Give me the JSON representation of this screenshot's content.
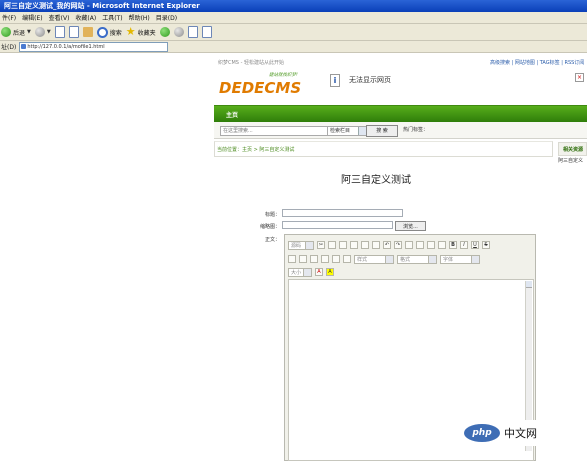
{
  "window": {
    "title": "阿三自定义测试_我的网站 - Microsoft Internet Explorer"
  },
  "menu": [
    "件(F)",
    "编辑(E)",
    "查看(V)",
    "收藏(A)",
    "工具(T)",
    "帮助(H)",
    "目录(D)"
  ],
  "toolbar": {
    "back_label": "后退",
    "search_label": "搜索",
    "favorites_label": "收藏夹"
  },
  "address": {
    "label": "址(D)",
    "url": "http://127.0.0.1/a/mofile1.html"
  },
  "site": {
    "topline": "织梦CMS - 轻松建站从此开始",
    "toplinks": "高级搜索 | 网站地图 | TAG标签 | RSS订阅",
    "logo_text": "DEDECMS",
    "logo_tagline": "建站就找织梦!",
    "notice_title": "无法显示网页",
    "nav_home": "主页",
    "search_placeholder": "在这里搜索...",
    "search_select": "检索栏目",
    "search_button": "搜 索",
    "hot_label": "热门标签：",
    "breadcrumb": "当前位置：主页 > 阿三自定义测试",
    "side_title": "相关资源",
    "side_item": "阿三自定义",
    "article_title": "阿三自定义测试"
  },
  "form": {
    "title_label": "标题：",
    "image_label": "缩略图：",
    "browse_button": "浏览...",
    "body_label": "正文：",
    "editor_source": "源码",
    "editor_format": "样式",
    "editor_paragraph": "格式",
    "editor_font": "字体",
    "editor_size": "大小"
  },
  "watermark": {
    "logo": "php",
    "text": "中文网"
  }
}
